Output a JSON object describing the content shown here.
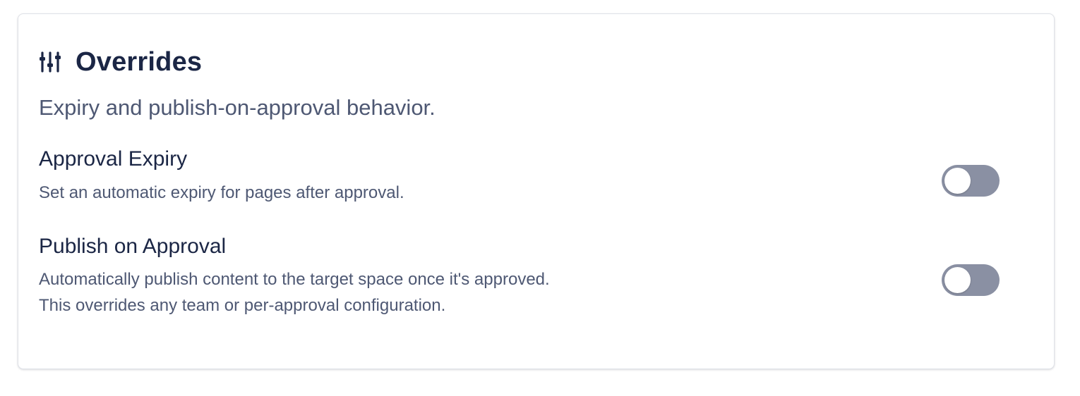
{
  "card": {
    "title": "Overrides",
    "title_icon": "sliders-icon",
    "subtitle": "Expiry and publish-on-approval behavior."
  },
  "settings": [
    {
      "label": "Approval Expiry",
      "description_lines": [
        "Set an automatic expiry for pages after approval."
      ],
      "enabled": false
    },
    {
      "label": "Publish on Approval",
      "description_lines": [
        "Automatically publish content to the target space once it's approved.",
        "This overrides any team or per-approval configuration."
      ],
      "enabled": false
    }
  ],
  "colors": {
    "heading": "#1b2645",
    "muted_text": "#4e5873",
    "toggle_off": "#8a90a3",
    "card_border": "#dfe2e8"
  }
}
